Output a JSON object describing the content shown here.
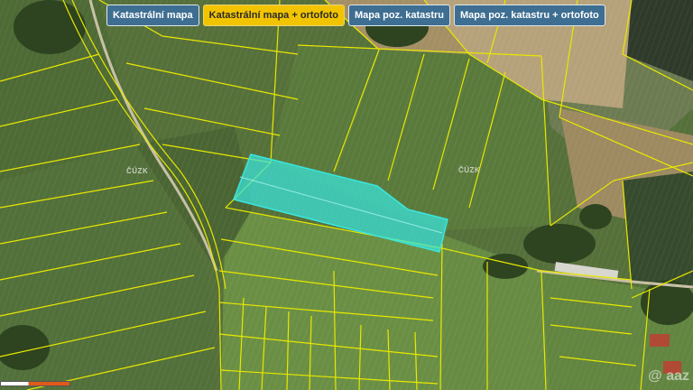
{
  "tabs": [
    {
      "label": "Katastrální mapa",
      "active": false
    },
    {
      "label": "Katastrální mapa + ortofoto",
      "active": true
    },
    {
      "label": "Mapa poz. katastru",
      "active": false
    },
    {
      "label": "Mapa poz. katastru + ortofoto",
      "active": false
    }
  ],
  "map": {
    "labels": [
      "ČÚZK",
      "ČÚZK"
    ],
    "watermark": "@ aaz",
    "parcel_line_color": "#e8e800",
    "highlight_color": "#39e6de"
  }
}
